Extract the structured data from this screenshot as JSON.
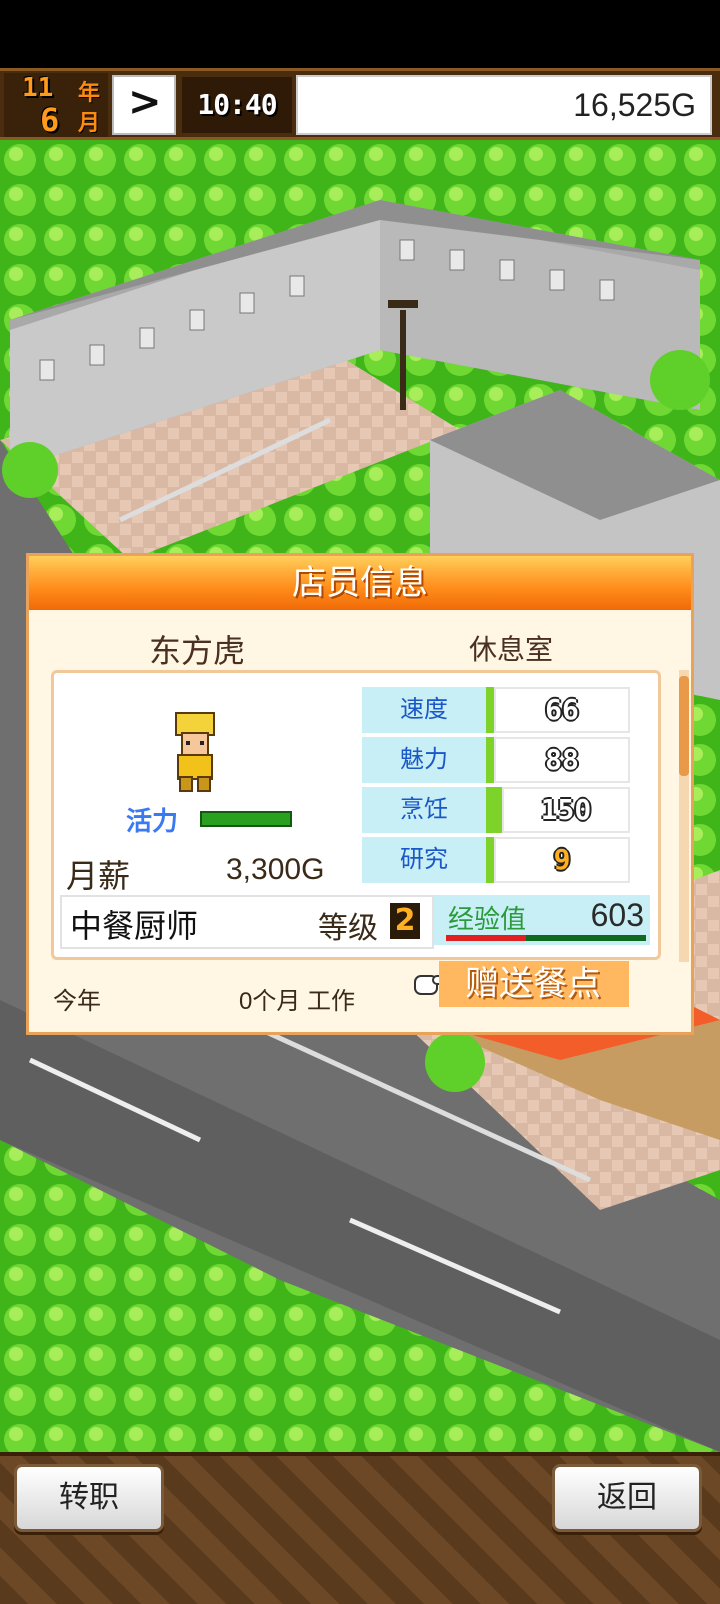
{
  "topbar": {
    "year_num": "11",
    "year_unit": "年",
    "month_num": "6",
    "month_unit": "月",
    "speed_symbol": ">",
    "time": "10:40",
    "money": "16,525G"
  },
  "panel": {
    "title": "店员信息",
    "name": "东方虎",
    "location": "休息室",
    "vitality_label": "活力",
    "salary_label": "月薪",
    "salary_value": "3,300G",
    "stats": [
      {
        "label": "速度",
        "value": "66"
      },
      {
        "label": "魅力",
        "value": "88"
      },
      {
        "label": "烹饪",
        "value": "150"
      },
      {
        "label": "研究",
        "value": "9"
      }
    ],
    "job": "中餐厨师",
    "level_label": "等级",
    "level_value": "2",
    "exp_label": "经验值",
    "exp_value": "603",
    "exp_progress": 0.4,
    "footer_year": "今年",
    "footer_time": "0个月 工作",
    "gift_button": "赠送餐点"
  },
  "bottom": {
    "left_button": "转职",
    "right_button": "返回"
  },
  "colors": {
    "panel_title": "#ff8c1a",
    "stat_label_bg": "#c8eef6",
    "gift_bg": "#ffb860"
  }
}
